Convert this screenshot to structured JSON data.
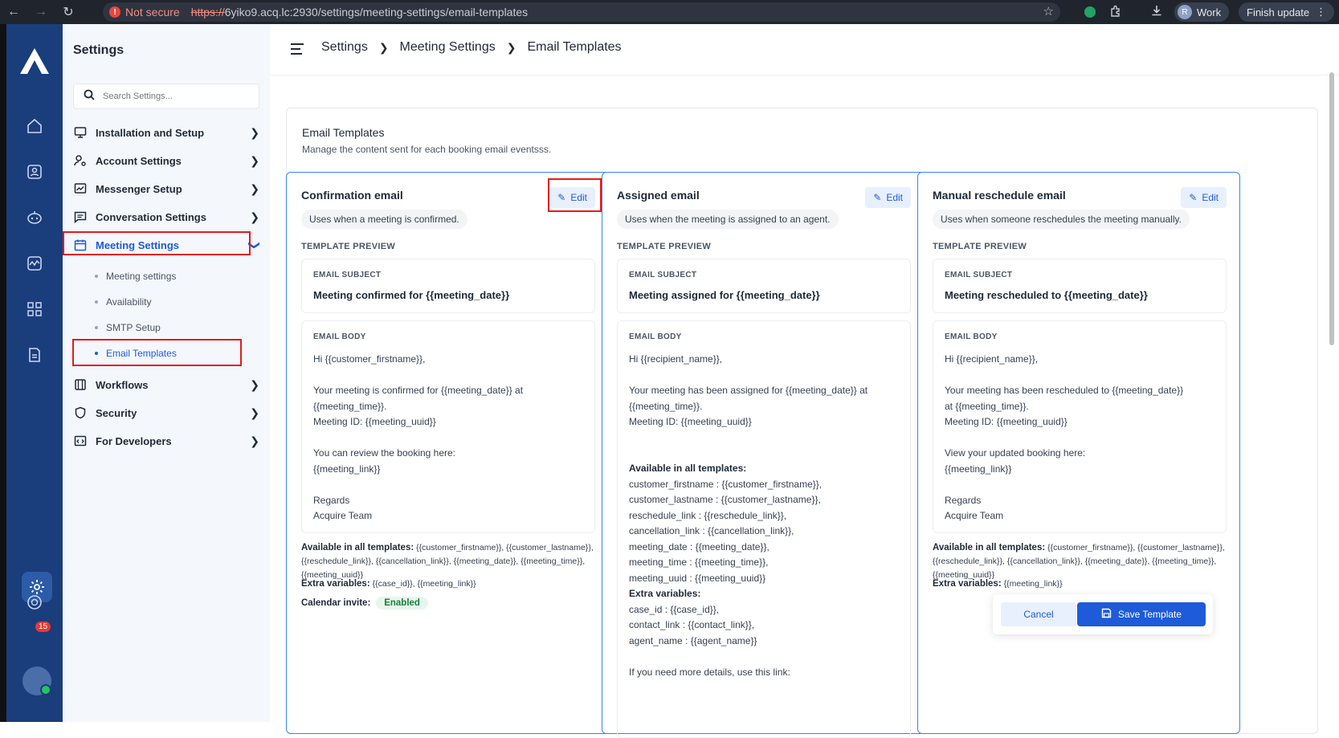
{
  "browser": {
    "not_secure": "Not secure",
    "url_scheme": "https://",
    "url_rest": "6yiko9.acq.lc:2930/settings/meeting-settings/email-templates",
    "profile_initial": "R",
    "profile_name": "Work",
    "finish_update": "Finish update"
  },
  "rail": {
    "notification_count": "15"
  },
  "sidebar": {
    "title": "Settings",
    "search_placeholder": "Search Settings...",
    "items": [
      {
        "label": "Installation and Setup"
      },
      {
        "label": "Account Settings"
      },
      {
        "label": "Messenger Setup"
      },
      {
        "label": "Conversation Settings"
      },
      {
        "label": "Meeting Settings"
      },
      {
        "label": "Workflows"
      },
      {
        "label": "Security"
      },
      {
        "label": "For Developers"
      }
    ],
    "sub_items": [
      {
        "label": "Meeting settings"
      },
      {
        "label": "Availability"
      },
      {
        "label": "SMTP Setup"
      },
      {
        "label": "Email Templates"
      }
    ]
  },
  "breadcrumb": [
    "Settings",
    "Meeting Settings",
    "Email Templates"
  ],
  "panel": {
    "title": "Email Templates",
    "subtitle": "Manage the content sent for each booking email eventsss."
  },
  "labels": {
    "edit": "Edit",
    "template_preview": "TEMPLATE PREVIEW",
    "email_subject": "EMAIL SUBJECT",
    "email_body": "EMAIL BODY",
    "available_label": "Available in all templates:",
    "extra_label": "Extra variables:",
    "calendar_label": "Calendar invite:",
    "enabled": "Enabled"
  },
  "cards": [
    {
      "title": "Confirmation email",
      "description": "Uses when a meeting is confirmed.",
      "subject": "Meeting confirmed for {{meeting_date}}",
      "body": "Hi {{customer_firstname}},\n\nYour meeting is confirmed for {{meeting_date}} at\n{{meeting_time}}.\nMeeting ID: {{meeting_uuid}}\n\nYou can review the booking here:\n{{meeting_link}}\n\nRegards\nAcquire Team",
      "available": "{{customer_firstname}}, {{customer_lastname}}, {{reschedule_link}}, {{cancellation_link}}, {{meeting_date}}, {{meeting_time}}, {{meeting_uuid}}",
      "extra": "{{case_id}}, {{meeting_link}}"
    },
    {
      "title": "Assigned email",
      "description": "Uses when the meeting is assigned to an agent.",
      "subject": "Meeting assigned for {{meeting_date}}",
      "body": "Hi {{recipient_name}},\n\nYour meeting has been assigned for {{meeting_date}} at\n{{meeting_time}}.\nMeeting ID: {{meeting_uuid}}",
      "available_heading": "Available in all templates:",
      "available_lines": [
        "customer_firstname : {{customer_firstname}},",
        "customer_lastname : {{customer_lastname}},",
        "reschedule_link : {{reschedule_link}},",
        "cancellation_link : {{cancellation_link}},",
        "meeting_date : {{meeting_date}},",
        "meeting_time : {{meeting_time}},",
        "meeting_uuid : {{meeting_uuid}}"
      ],
      "extra_heading": "Extra variables:",
      "extra_lines": [
        "case_id : {{case_id}},",
        "contact_link : {{contact_link}},",
        "agent_name : {{agent_name}}"
      ],
      "trailing": "If you need more details, use this link:"
    },
    {
      "title": "Manual reschedule email",
      "description": "Uses when someone reschedules the meeting manually.",
      "subject": "Meeting rescheduled to {{meeting_date}}",
      "body": "Hi {{recipient_name}},\n\nYour meeting has been rescheduled to {{meeting_date}}\nat {{meeting_time}}.\nMeeting ID: {{meeting_uuid}}\n\nView your updated booking here:\n{{meeting_link}}\n\nRegards\nAcquire Team",
      "available": "{{customer_firstname}}, {{customer_lastname}}, {{reschedule_link}}, {{cancellation_link}}, {{meeting_date}}, {{meeting_time}}, {{meeting_uuid}}",
      "extra": "{{meeting_link}}"
    }
  ],
  "actions": {
    "cancel": "Cancel",
    "save": "Save Template"
  }
}
